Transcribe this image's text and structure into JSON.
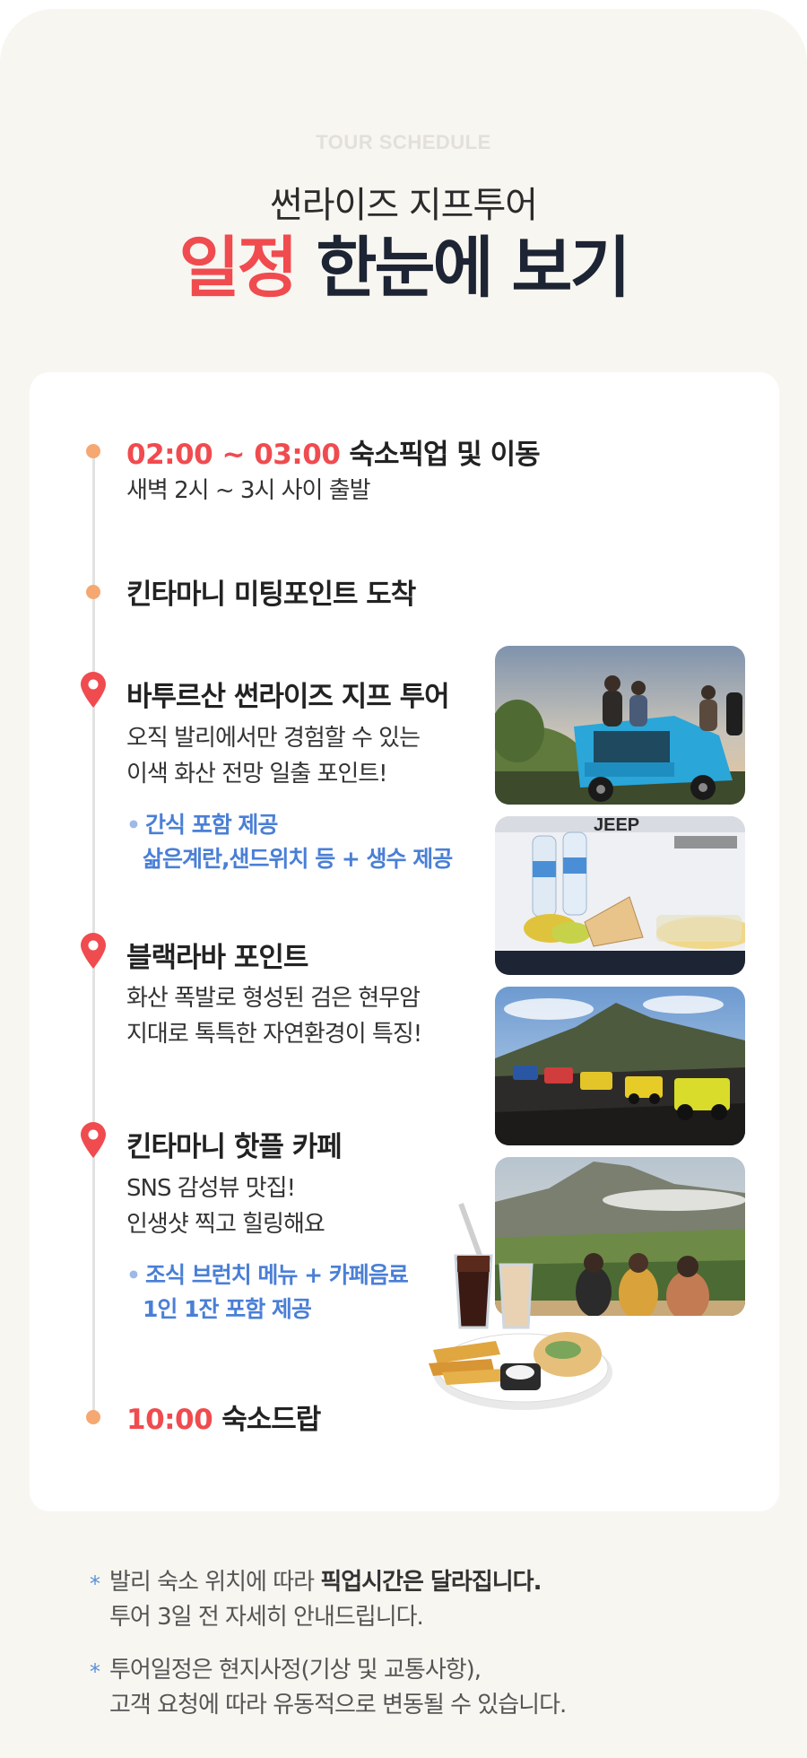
{
  "header": {
    "eyebrow": "TOUR SCHEDULE",
    "subtitle": "썬라이즈 지프투어",
    "headline_accent": "일정",
    "headline_rest": "한눈에 보기"
  },
  "timeline": [
    {
      "time": "02:00 ~ 03:00",
      "title": "숙소픽업 및 이동",
      "desc": [
        "새벽 2시 ~ 3시 사이 출발"
      ],
      "marker": "dot-icon"
    },
    {
      "time": "",
      "title": "킨타마니 미팅포인트 도착",
      "desc": [],
      "marker": "dot-icon"
    },
    {
      "time": "",
      "title": "바투르산 썬라이즈 지프 투어",
      "desc": [
        "오직 발리에서만 경험할 수 있는",
        "이색 화산 전망 일출 포인트!"
      ],
      "note": [
        "간식 포함 제공",
        "삶은계란,샌드위치 등 + 생수 제공"
      ],
      "marker": "location-pin-icon"
    },
    {
      "time": "",
      "title": "블랙라바 포인트",
      "desc": [
        "화산 폭발로 형성된 검은 현무암",
        "지대로 톡특한 자연환경이 특징!"
      ],
      "marker": "location-pin-icon"
    },
    {
      "time": "",
      "title": "킨타마니 핫플 카페",
      "desc": [
        "SNS 감성뷰 맛집!",
        "인생샷 찍고 힐링해요"
      ],
      "note": [
        "조식 브런치 메뉴 + 카페음료",
        "1인 1잔 포함 제공"
      ],
      "marker": "location-pin-icon"
    },
    {
      "time": "10:00",
      "title": "숙소드랍",
      "desc": [],
      "marker": "dot-icon"
    }
  ],
  "footnotes": [
    {
      "line1_pre": "발리 숙소 위치에 따라 ",
      "line1_bold": "픽업시간은 달라집니다.",
      "line2": "투어 3일 전 자세히 안내드립니다."
    },
    {
      "line1": "투어일정은 현지사정(기상 및 교통사항),",
      "line2": "고객 요청에 따라 유동적으로 변동될 수 있습니다."
    }
  ],
  "colors": {
    "accent_red": "#f04b4f",
    "dark_navy": "#1d2433",
    "note_blue": "#4a7fd6",
    "dot_orange": "#f5a871",
    "background": "#f8f6f1"
  },
  "images": [
    "jeep-sunrise-photo",
    "snack-breakfast-photo",
    "black-lava-jeeps-photo",
    "kintamani-cafe-view-photo",
    "brunch-plate-photo"
  ],
  "photo_texts": {
    "jeep_badge": "JEEP"
  }
}
